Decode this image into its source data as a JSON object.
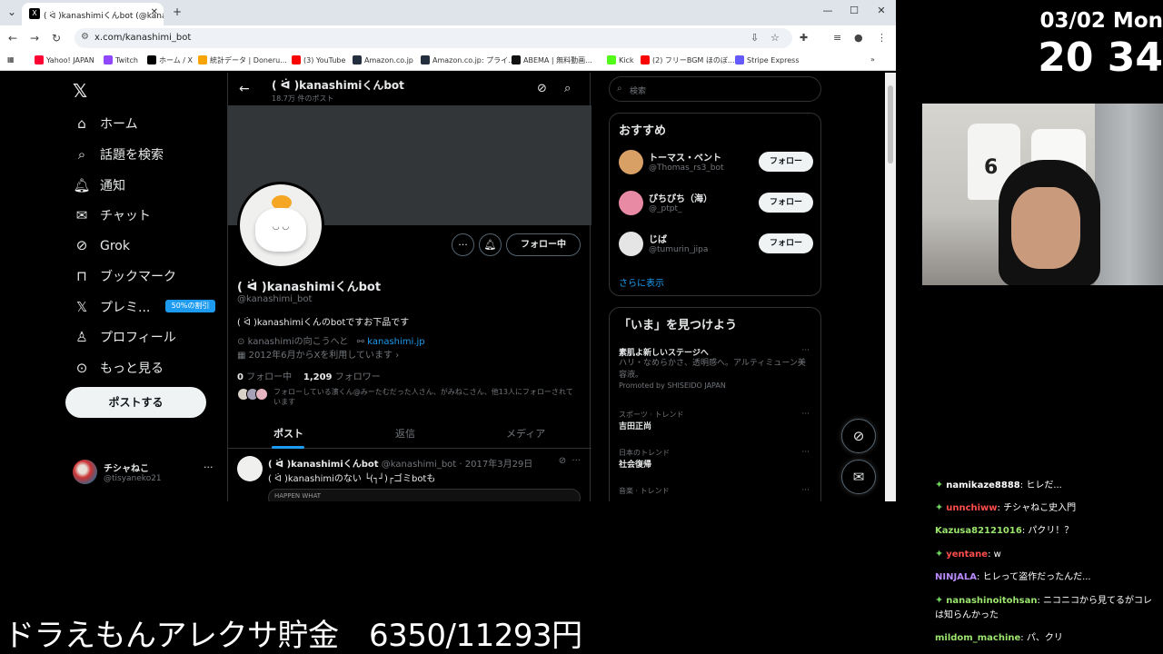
{
  "browser": {
    "tab_title": "( ᐛ )kanashimiくんbot (@kana",
    "url": "x.com/kanashimi_bot",
    "bookmarks": [
      "Yahoo! JAPAN",
      "Twitch",
      "ホーム / X",
      "統計データ | Doneru...",
      "(3) YouTube",
      "Amazon.co.jp",
      "Amazon.co.jp: プライ...",
      "ABEMA | 無料動画...",
      "Kick",
      "(2) フリーBGM ほのぼ...",
      "Stripe Express"
    ]
  },
  "nav": {
    "items": [
      "ホーム",
      "話題を検索",
      "通知",
      "チャット",
      "Grok",
      "ブックマーク",
      "プレミ...",
      "プロフィール",
      "もっと見る"
    ],
    "premium_badge": "50%の割引",
    "post_button": "ポストする",
    "account_name": "チシャねこ",
    "account_handle": "@tisyaneko21"
  },
  "profile": {
    "header_title": "( ᐛ )kanashimiくんbot",
    "post_count": "18.7万 件のポスト",
    "following_button": "フォロー中",
    "name": "( ᐛ )kanashimiくんbot",
    "handle": "@kanashimi_bot",
    "bio": "( ᐛ )kanashimiくんのbotですお下品です",
    "location": "kanashimiの向こうへと",
    "link": "kanashimi.jp",
    "joined": "2012年6月からXを利用しています",
    "following_count": "0",
    "following_label": "フォロー中",
    "followers_count": "1,209",
    "followers_label": "フォロワー",
    "known_followers": "フォローしている濱くん@みーたむだった人さん、がみねこさん、他13人にフォローされています",
    "tabs": [
      "ポスト",
      "返信",
      "メディア"
    ]
  },
  "tweet": {
    "name": "( ᐛ )kanashimiくんbot",
    "handle": "@kanashimi_bot",
    "date": "2017年3月29日",
    "text": "( ᐛ )kanashimiのない └(┐┘)┌ゴミbotも",
    "media_text": "HAPPEN WHAT"
  },
  "right": {
    "search_placeholder": "検索",
    "recommend_title": "おすすめ",
    "recommend": [
      {
        "name": "トーマス・ベント",
        "handle": "@Thomas_rs3_bot",
        "button": "フォロー"
      },
      {
        "name": "ぴちぴち（海）",
        "handle": "@_ptpt_",
        "button": "フォロー"
      },
      {
        "name": "じば",
        "handle": "@tumurin_jipa",
        "button": "フォロー"
      }
    ],
    "show_more": "さらに表示",
    "trends_title": "「いま」を見つけよう",
    "trends": [
      {
        "top": "",
        "title": "素肌よ新しいステージへ",
        "desc": "ハリ・なめらかさ、透明感へ。アルティミューン美容液。",
        "promo": "Promoted by SHISEIDO JAPAN"
      },
      {
        "top": "スポーツ · トレンド",
        "title": "吉田正尚",
        "desc": "",
        "promo": ""
      },
      {
        "top": "日本のトレンド",
        "title": "社会復帰",
        "desc": "",
        "promo": ""
      },
      {
        "top": "音楽 · トレンド",
        "title": "",
        "desc": "",
        "promo": ""
      }
    ]
  },
  "overlay": {
    "date": "03/02 Mon",
    "time": "20 34",
    "savings": "ドラえもんアレクサ貯金　6350/11293円",
    "chat": [
      {
        "user": "namikaze8888",
        "msg": ": ヒレだ...",
        "gem": true,
        "color": "#ffffff"
      },
      {
        "user": "unnchiww",
        "msg": ": チシャねこ史入門",
        "gem": true,
        "color": "#ff4d4d"
      },
      {
        "user": "Kazusa82121016",
        "msg": ": パクリ！？",
        "gem": false,
        "color": "#9be46d"
      },
      {
        "user": "yentane",
        "msg": ": w",
        "gem": true,
        "color": "#ff4d4d"
      },
      {
        "user": "NINJALA",
        "msg": ": ヒレって盗作だったんだ...",
        "gem": false,
        "color": "#b98cff"
      },
      {
        "user": "nanashinoitohsan",
        "msg": ": ニコニコから見てるがコレは知らんかった",
        "gem": true,
        "color": "#9be46d"
      },
      {
        "user": "mildom_machine",
        "msg": ": パ、クリ",
        "gem": false,
        "color": "#9be46d"
      }
    ]
  }
}
